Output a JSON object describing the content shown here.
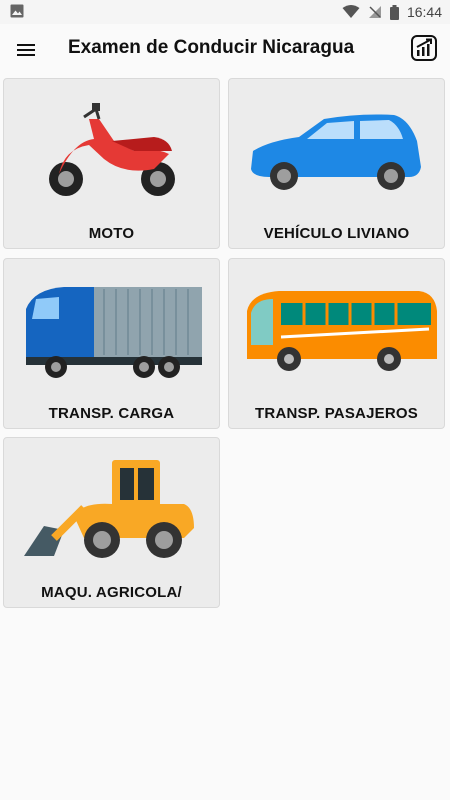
{
  "status_bar": {
    "time": "16:44",
    "icons": [
      "image-icon",
      "wifi-icon",
      "no-signal-icon",
      "battery-icon"
    ]
  },
  "app_bar": {
    "title": "Examen de Conducir Nicaragua",
    "left_icon": "menu-icon",
    "right_icon": "stats-chart-icon"
  },
  "categories": [
    {
      "label": "MOTO",
      "icon": "motorcycle-icon",
      "color": "#e53935"
    },
    {
      "label": "VEHÍCULO LIVIANO",
      "icon": "car-icon",
      "color": "#1e88e5"
    },
    {
      "label": "TRANSP. CARGA",
      "icon": "truck-icon",
      "color": "#1565c0"
    },
    {
      "label": "TRANSP. PASAJEROS",
      "icon": "bus-icon",
      "color": "#fb8c00"
    },
    {
      "label": "MAQU. AGRICOLA/",
      "icon": "bulldozer-icon",
      "color": "#f9a825"
    }
  ]
}
